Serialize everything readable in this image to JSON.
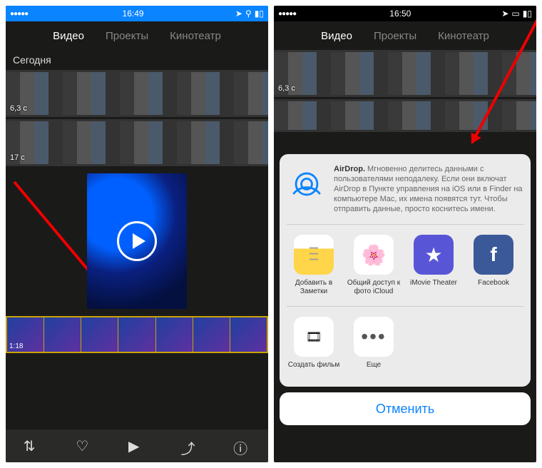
{
  "screens": [
    {
      "time": "16:49",
      "status": "blue",
      "tabs": [
        "Видео",
        "Проекты",
        "Кинотеатр"
      ],
      "active": 0,
      "section": "Сегодня",
      "durations": [
        "6,3 с",
        "17 с"
      ],
      "video": {
        "timeline_time": "1:18"
      },
      "bottom": [
        "sort",
        "heart",
        "play",
        "share",
        "info"
      ]
    },
    {
      "time": "16:50",
      "status": "dark",
      "tabs": [
        "Видео",
        "Проекты",
        "Кинотеатр"
      ],
      "active": 0,
      "durations": [
        "6,3 с"
      ],
      "sheet": {
        "airdrop": {
          "bold": "AirDrop.",
          "text": " Мгновенно делитесь данными с пользователями неподалеку. Если они включат AirDrop в Пункте управления на iOS или в Finder на компьютере Mac, их имена появятся тут. Чтобы отправить данные, просто коснитесь имени."
        },
        "row1": [
          {
            "label": "Добавить в Заметки",
            "bg": "#fff",
            "icon": "notes"
          },
          {
            "label": "Общий доступ к фото iCloud",
            "bg": "#fff",
            "icon": "photos"
          },
          {
            "label": "iMovie Theater",
            "bg": "#5856d6",
            "icon": "star"
          },
          {
            "label": "Facebook",
            "bg": "#3b5998",
            "icon": "fb"
          }
        ],
        "row2": [
          {
            "label": "Создать фильм",
            "bg": "#fff",
            "icon": "film"
          },
          {
            "label": "Еще",
            "bg": "#fff",
            "icon": "more"
          }
        ],
        "cancel": "Отменить"
      }
    }
  ]
}
